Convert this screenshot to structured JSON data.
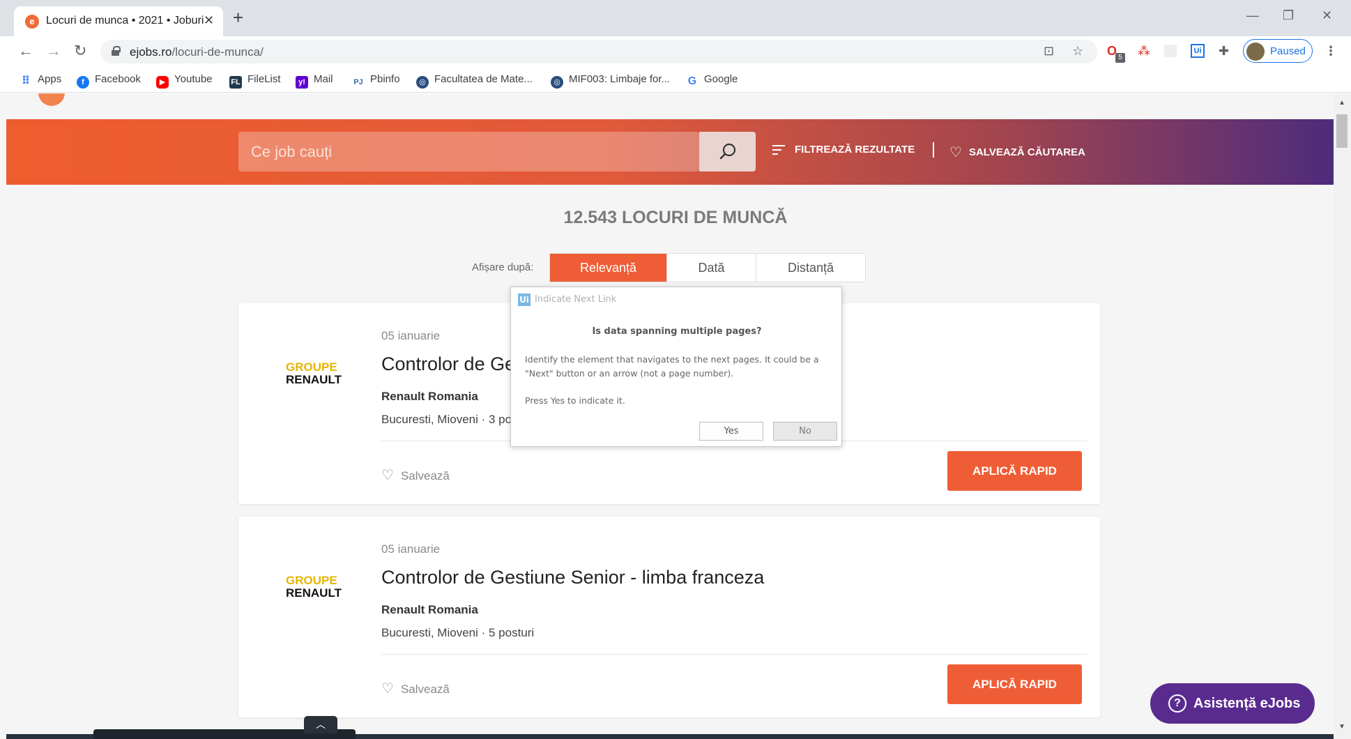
{
  "browser": {
    "tab_title": "Locuri de munca • 2021 • Joburi",
    "tab_close": "✕",
    "new_tab": "+",
    "url_host": "ejobs.ro",
    "url_path": "/locuri-de-munca/",
    "profile_label": "Paused",
    "extension_badge": "5",
    "window_controls": {
      "minimize": "—",
      "restore": "❐",
      "close": "✕"
    }
  },
  "bookmarks": [
    {
      "label": "Apps",
      "icon": "apps-grid-icon",
      "color": "#4285f4"
    },
    {
      "label": "Facebook",
      "icon": "facebook-icon",
      "color": "#1877f2"
    },
    {
      "label": "Youtube",
      "icon": "youtube-icon",
      "color": "#ff0000"
    },
    {
      "label": "FileList",
      "icon": "filelist-icon",
      "color": "#1f3a4d"
    },
    {
      "label": "Mail",
      "icon": "yahoo-mail-icon",
      "color": "#6001d2"
    },
    {
      "label": "Pbinfo",
      "icon": "pbinfo-icon",
      "color": "#3b6bb0"
    },
    {
      "label": "Facultatea de Mate...",
      "icon": "university-icon",
      "color": "#2b4c7e"
    },
    {
      "label": "MIF003: Limbaje for...",
      "icon": "university-icon",
      "color": "#2b4c7e"
    },
    {
      "label": "Google",
      "icon": "google-icon",
      "color": "#4285f4"
    }
  ],
  "header": {
    "search_placeholder": "Ce job cauți",
    "filter_label": "FILTREAZĂ REZULTATE",
    "save_search_label": "SALVEAZĂ CĂUTAREA"
  },
  "results": {
    "count_label": "12.543 LOCURI DE MUNCĂ",
    "sort_label": "Afișare după:",
    "sort_options": [
      "Relevanță",
      "Dată",
      "Distanță"
    ],
    "active_sort": "Relevanță"
  },
  "jobs": [
    {
      "date": "05 ianuarie",
      "title": "Controlor de Gestiune Junior - limba franceza",
      "company": "Renault Romania",
      "location": "Bucuresti, Mioveni · 3 posturi",
      "logo_line1": "GROUPE",
      "logo_line2": "RENAULT",
      "save_label": "Salvează",
      "apply_label": "APLICĂ RAPID"
    },
    {
      "date": "05 ianuarie",
      "title": "Controlor de Gestiune Senior - limba franceza",
      "company": "Renault Romania",
      "location": "Bucuresti, Mioveni · 5 posturi",
      "logo_line1": "GROUPE",
      "logo_line2": "RENAULT",
      "save_label": "Salvează",
      "apply_label": "APLICĂ RAPID"
    }
  ],
  "dialog": {
    "logo": "Ui",
    "title": "Indicate Next Link",
    "question": "Is data spanning multiple pages?",
    "description": "Identify the element that navigates to the next pages. It could be a \"Next\" button or an arrow (not a page number).",
    "instruction": "Press Yes to indicate it.",
    "yes_label": "Yes",
    "no_label": "No"
  },
  "assist": {
    "label": "Asistență eJobs",
    "icon": "?"
  },
  "colors": {
    "accent": "#ef5d36",
    "hero_start": "#ee5d2e",
    "hero_end": "#4e2b7c",
    "assist_bg": "#5a2b8f",
    "logo_yellow": "#e8b500"
  }
}
